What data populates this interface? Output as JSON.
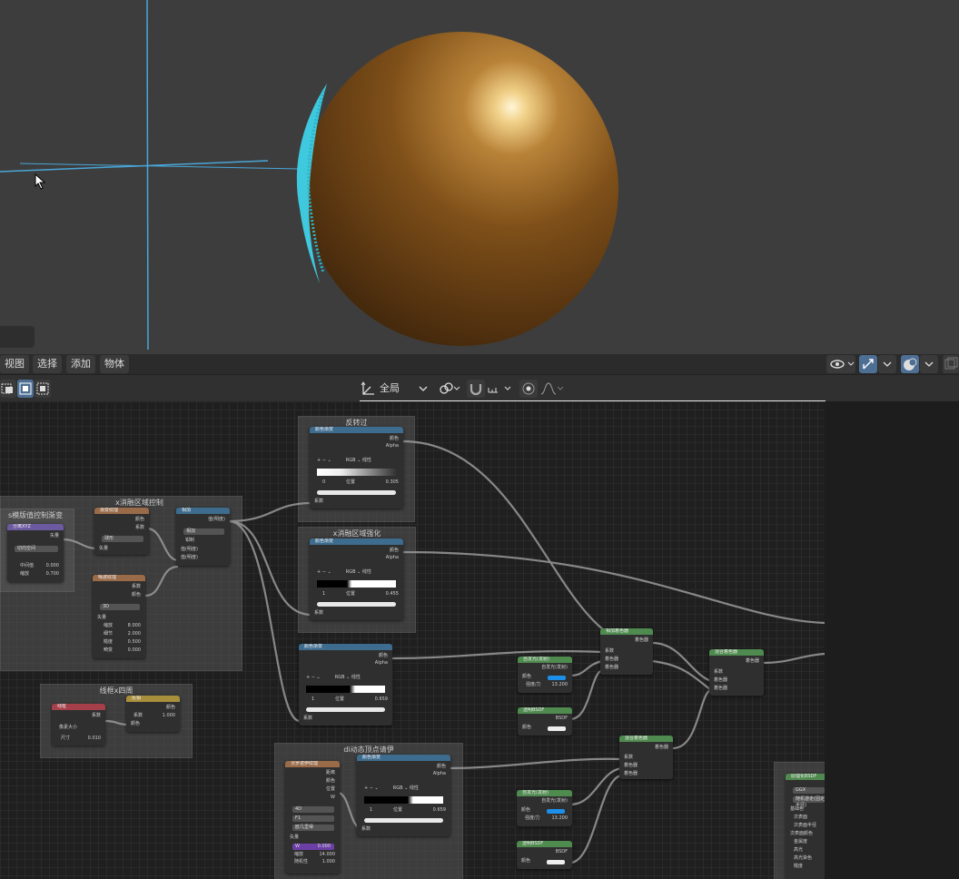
{
  "viewport_header": {
    "menus": [
      "视图",
      "选择",
      "添加",
      "物体"
    ]
  },
  "node_editor_header": {
    "scope": "全局"
  },
  "frames": [
    {
      "title": "反转过"
    },
    {
      "title": "x消融区域控制"
    },
    {
      "title": "x消融区域强化"
    },
    {
      "title": "s模版值控制渐变"
    },
    {
      "title": "线框x四周"
    },
    {
      "title": "di动态顶点请伊"
    }
  ],
  "nodes": {
    "ramp_top": {
      "title": "颜色渐变",
      "out1": "颜色",
      "out2": "Alpha",
      "mode": "RGB",
      "interp": "线性",
      "index": "0",
      "pos_label": "位置",
      "pos": "0.305",
      "in": "系数"
    },
    "ramp_mid": {
      "title": "颜色渐变",
      "out1": "颜色",
      "out2": "Alpha",
      "mode": "RGB",
      "interp": "线性",
      "index": "1",
      "pos_label": "位置",
      "pos": "0.455",
      "in": "系数"
    },
    "ramp_low": {
      "title": "颜色渐变",
      "out1": "颜色",
      "out2": "Alpha",
      "mode": "RGB",
      "interp": "线性",
      "index": "1",
      "pos_label": "位置",
      "pos": "0.659",
      "in": "系数"
    },
    "ramp_bot": {
      "title": "颜色渐变",
      "out1": "颜色",
      "out2": "Alpha",
      "mode": "RGB",
      "interp": "线性",
      "index": "1",
      "pos_label": "位置",
      "pos": "0.659",
      "in": "系数"
    },
    "sep": {
      "title": "分离XYZ",
      "out": "矢量",
      "field": "切向空间",
      "l1": "中间值",
      "v1": "0.000",
      "l2": "缩放",
      "v2": "0.700"
    },
    "texcoord": {
      "title": "渐变纹理",
      "o1": "颜色",
      "o2": "系数",
      "field": "球形",
      "in": "矢量"
    },
    "noise": {
      "title": "噪波纹理",
      "o1": "系数",
      "o2": "颜色",
      "field": "3D",
      "in": "矢量",
      "l1": "缩放",
      "v1": "8.000",
      "l2": "细节",
      "v2": "2.000",
      "l3": "糙度",
      "v3": "0.500",
      "l4": "畸变",
      "v4": "0.000"
    },
    "mix": {
      "title": "相加",
      "out": "值(明度)",
      "f1": "相加",
      "chk": "钳制",
      "i1": "值(明度)",
      "i2": "值(明度)"
    },
    "wire": {
      "title": "线框",
      "out": "系数",
      "chk": "像素大小",
      "l": "尺寸",
      "v": "0.010"
    },
    "invert": {
      "title": "反相",
      "out": "颜色",
      "l": "系数",
      "v": "1.000",
      "i": "颜色"
    },
    "addshader1": {
      "title": "相加着色器",
      "out": "着色器",
      "i1": "系数",
      "i2": "着色器",
      "i3": "着色器"
    },
    "addshader2": {
      "title": "混合着色器",
      "out": "着色器",
      "i1": "系数",
      "i2": "着色器",
      "i3": "着色器"
    },
    "addshader3": {
      "title": "混合着色器",
      "out": "着色器",
      "i1": "系数",
      "i2": "着色器",
      "i3": "着色器"
    },
    "emit1": {
      "title": "自发光(发射)",
      "out": "自发光(发射)",
      "c": "颜色",
      "l": "强度/力",
      "v": "13.200"
    },
    "emit2": {
      "title": "自发光(发射)",
      "out": "自发光(发射)",
      "c": "颜色",
      "l": "强度/力",
      "v": "13.200"
    },
    "transp1": {
      "title": "透明BSDF",
      "out": "BSDF",
      "c": "颜色"
    },
    "transp2": {
      "title": "透明BSDF",
      "out": "BSDF",
      "c": "颜色"
    },
    "wave": {
      "title": "沃罗诺伊纹理",
      "o1": "距离",
      "o2": "颜色",
      "o3": "位置",
      "o4": "W",
      "f1": "4D",
      "f2": "F1",
      "f3": "欧几里得",
      "in": "矢量",
      "l1": "W",
      "v1": "0.000",
      "l2": "缩放",
      "v2": "14.000",
      "l3": "随机性",
      "v3": "1.000"
    },
    "principled": {
      "title": "原理化BSDF",
      "f1": "GGX",
      "f2": "随机游走(固定半径)",
      "r1": "基础色",
      "r2": "次表面",
      "r3": "次表面半径",
      "r4": "次表面颜色",
      "r5": "金属度",
      "r6": "高光",
      "r7": "高光染色",
      "r8": "糙度"
    }
  },
  "colors": {
    "sphere": "#8a5a1e",
    "xray_edge": "#3fd8f0",
    "axis_line": "#4aa6d8",
    "emit_color": "#1e8fe8"
  }
}
